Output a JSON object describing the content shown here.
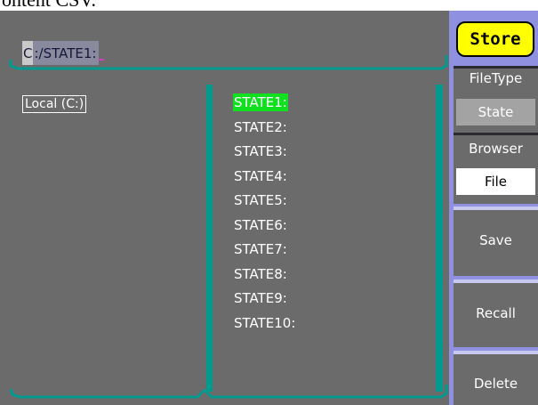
{
  "doc_text": "ontent CSV.",
  "path": {
    "drive_letter": "C",
    "rest": ":/STATE1:"
  },
  "drives": [
    {
      "label": "Local (C:)"
    }
  ],
  "files": [
    {
      "name": "STATE1:",
      "selected": true
    },
    {
      "name": "STATE2:",
      "selected": false
    },
    {
      "name": "STATE3:",
      "selected": false
    },
    {
      "name": "STATE4:",
      "selected": false
    },
    {
      "name": "STATE5:",
      "selected": false
    },
    {
      "name": "STATE6:",
      "selected": false
    },
    {
      "name": "STATE7:",
      "selected": false
    },
    {
      "name": "STATE8:",
      "selected": false
    },
    {
      "name": "STATE9:",
      "selected": false
    },
    {
      "name": "STATE10:",
      "selected": false
    }
  ],
  "menu": {
    "title": "Store",
    "filetype_label": "FileType",
    "filetype_value": "State",
    "browser_label": "Browser",
    "browser_value": "File",
    "save_label": "Save",
    "recall_label": "Recall",
    "delete_label": "Delete"
  },
  "colors": {
    "screen_bg": "#6b6b6b",
    "accent_teal": "#009a8e",
    "menu_border": "#9090e0",
    "title_bg": "#ffff00",
    "selection": "#10e020"
  }
}
